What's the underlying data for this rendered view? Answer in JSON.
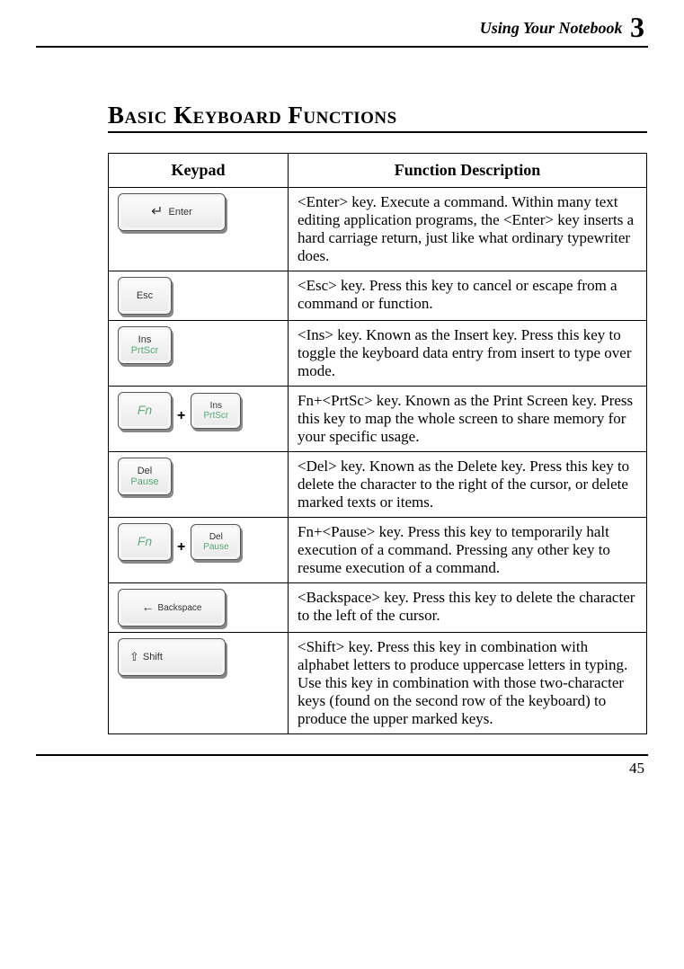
{
  "running_head": {
    "text": "Using Your Notebook",
    "chapter_number": "3"
  },
  "section_title": "Basic Keyboard Functions",
  "table": {
    "headers": {
      "keypad": "Keypad",
      "desc": "Function Description"
    },
    "rows": [
      {
        "key_labels": {
          "primary": "Enter",
          "icon": "↵"
        },
        "desc": "<Enter> key. Execute a command. Within many text editing application programs, the <Enter> key inserts a hard carriage return, just like what ordinary typewriter does."
      },
      {
        "key_labels": {
          "primary": "Esc"
        },
        "desc": "<Esc> key. Press this key to cancel or escape from a command or function."
      },
      {
        "key_labels": {
          "line1": "Ins",
          "line2": "PrtScr"
        },
        "desc": "<Ins> key. Known as the Insert key. Press this key to toggle the keyboard data entry from insert to type over mode."
      },
      {
        "key_labels": {
          "combo_a": "Fn",
          "plus": "+",
          "combo_b_line1": "Ins",
          "combo_b_line2": "PrtScr"
        },
        "desc": "Fn+<PrtSc> key. Known as the Print Screen key. Press this key to map the whole screen to share memory for your specific usage."
      },
      {
        "key_labels": {
          "line1": "Del",
          "line2": "Pause"
        },
        "desc": "<Del> key. Known as the Delete key. Press this key to delete the character to the right of the cursor, or delete marked texts or items."
      },
      {
        "key_labels": {
          "combo_a": "Fn",
          "plus": "+",
          "combo_b_line1": "Del",
          "combo_b_line2": "Pause"
        },
        "desc": "Fn+<Pause> key. Press this key to temporarily halt execution of a command. Pressing any other key to resume execution of a command."
      },
      {
        "key_labels": {
          "primary": "Backspace",
          "icon": "←"
        },
        "desc": "<Backspace> key. Press this key to delete the character to the left of the cursor."
      },
      {
        "key_labels": {
          "primary": "Shift",
          "icon": "⇧"
        },
        "desc": "<Shift> key. Press this key in combination with alphabet letters to produce uppercase letters in typing. Use this key in combination with those two-character keys (found on the second row of the keyboard) to produce the upper marked keys."
      }
    ]
  },
  "page_number": "45"
}
